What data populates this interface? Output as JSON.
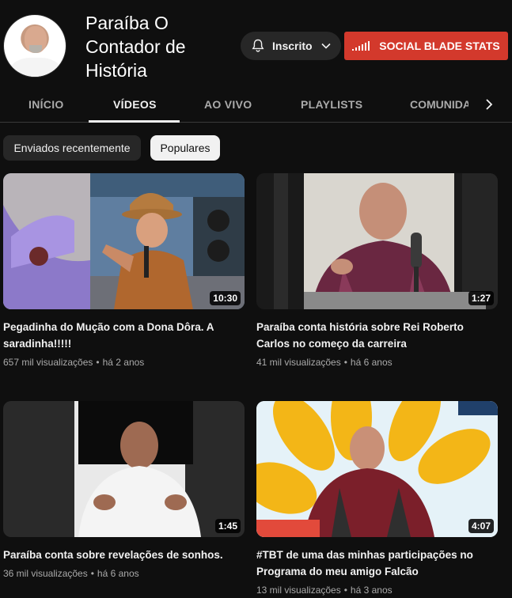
{
  "channel": {
    "name": "Paraíba O Contador de História",
    "subscribe_label": "Inscrito",
    "stats_label": "SOCIAL BLADE STATS"
  },
  "tabs": [
    {
      "label": "INÍCIO",
      "active": false
    },
    {
      "label": "VÍDEOS",
      "active": true
    },
    {
      "label": "AO VIVO",
      "active": false
    },
    {
      "label": "PLAYLISTS",
      "active": false
    },
    {
      "label": "COMUNIDADE",
      "active": false
    }
  ],
  "filters": {
    "recent": "Enviados recentemente",
    "popular": "Populares",
    "selected": "Populares"
  },
  "videos": [
    {
      "title": "Pegadinha do Mução com a Dona Dôra. A saradinha!!!!!",
      "duration": "10:30",
      "views": "657 mil visualizações",
      "age": "há 2 anos"
    },
    {
      "title": "Paraíba conta história sobre Rei Roberto Carlos no começo da carreira",
      "duration": "1:27",
      "views": "41 mil visualizações",
      "age": "há 6 anos"
    },
    {
      "title": "Paraíba conta sobre revelações de sonhos.",
      "duration": "1:45",
      "views": "36 mil visualizações",
      "age": "há 6 anos"
    },
    {
      "title": "#TBT de uma das minhas participações no Programa do meu amigo Falcão",
      "duration": "4:07",
      "views": "13 mil visualizações",
      "age": "há 3 anos"
    }
  ],
  "colors": {
    "background": "#0f0f0f",
    "chip_dark": "#272727",
    "stats_red": "#d3392c"
  },
  "icons": [
    "bell-icon",
    "chevron-down-icon",
    "signal-bars-icon",
    "chevron-right-icon"
  ]
}
